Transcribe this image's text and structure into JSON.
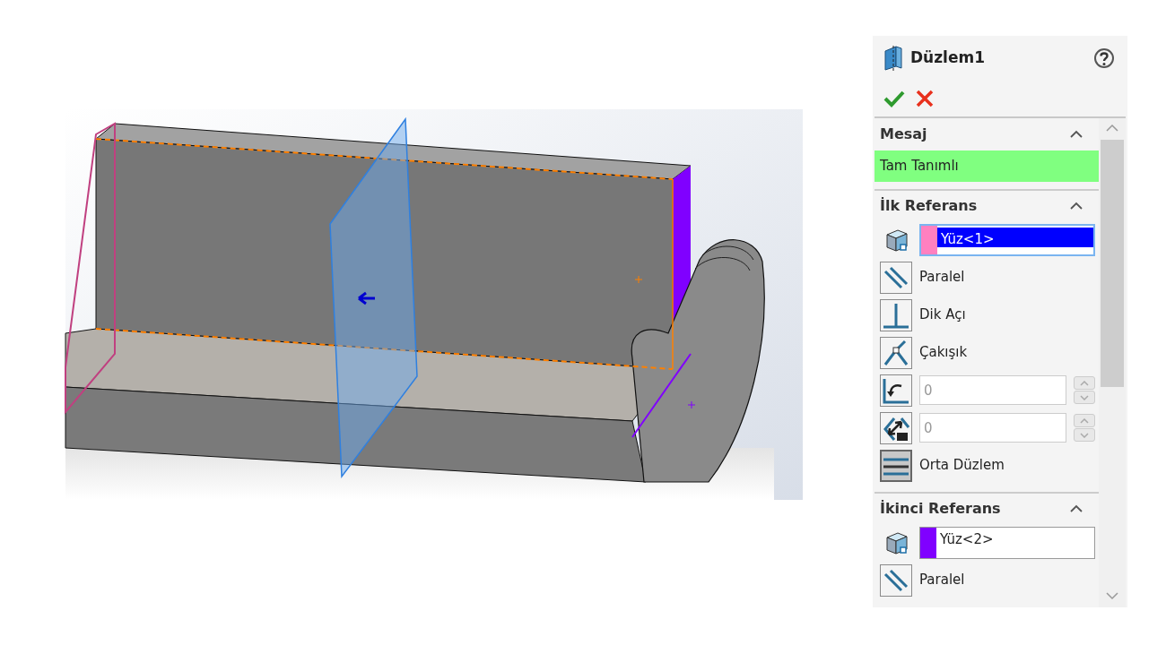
{
  "panel": {
    "title": "Düzlem1",
    "sections": [
      {
        "kind": "message",
        "title": "Mesaj",
        "expanded": true,
        "text": "Tam Tanımlı"
      },
      {
        "kind": "reference",
        "title": "İlk Referans",
        "expanded": true,
        "selection": {
          "text": "Yüz<1>",
          "color": "#ff80c0",
          "selected": true
        },
        "options": [
          {
            "kind": "parallel",
            "label": "Paralel",
            "selected": false
          },
          {
            "kind": "perpendicular",
            "label": "Dik Açı",
            "selected": false
          },
          {
            "kind": "coincident",
            "label": "Çakışık",
            "selected": false
          },
          {
            "kind": "angle",
            "value": "0",
            "disabled": true
          },
          {
            "kind": "distance",
            "value": "0",
            "disabled": true
          },
          {
            "kind": "midplane",
            "label": "Orta Düzlem",
            "selected": true
          }
        ]
      },
      {
        "kind": "reference",
        "title": "İkinci Referans",
        "expanded": true,
        "selection": {
          "text": "Yüz<2>",
          "color": "#8000ff",
          "selected": false
        },
        "options": [
          {
            "kind": "parallel",
            "label": "Paralel",
            "selected": false
          }
        ]
      }
    ]
  }
}
